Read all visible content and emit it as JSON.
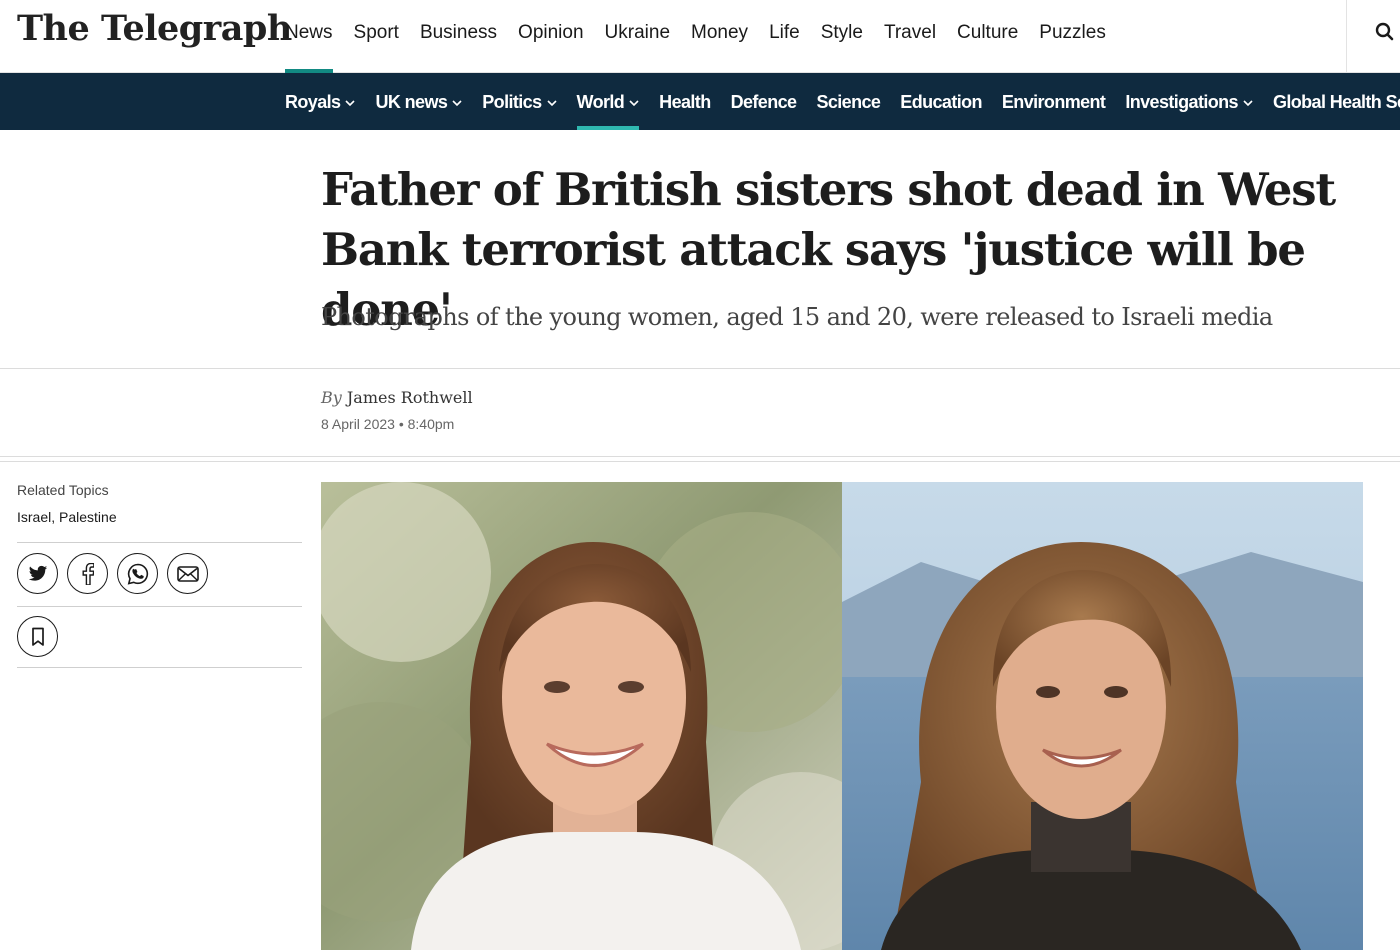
{
  "header": {
    "logo_text": "The Telegraph",
    "nav": [
      {
        "label": "News",
        "active": true
      },
      {
        "label": "Sport"
      },
      {
        "label": "Business"
      },
      {
        "label": "Opinion"
      },
      {
        "label": "Ukraine"
      },
      {
        "label": "Money"
      },
      {
        "label": "Life"
      },
      {
        "label": "Style"
      },
      {
        "label": "Travel"
      },
      {
        "label": "Culture"
      },
      {
        "label": "Puzzles"
      }
    ],
    "search_icon": "search-icon"
  },
  "section_nav": [
    {
      "label": "Royals",
      "dropdown": true
    },
    {
      "label": "UK news",
      "dropdown": true
    },
    {
      "label": "Politics",
      "dropdown": true
    },
    {
      "label": "World",
      "dropdown": true,
      "active": true
    },
    {
      "label": "Health"
    },
    {
      "label": "Defence"
    },
    {
      "label": "Science"
    },
    {
      "label": "Education"
    },
    {
      "label": "Environment"
    },
    {
      "label": "Investigations",
      "dropdown": true
    },
    {
      "label": "Global Health Security"
    }
  ],
  "article": {
    "headline": "Father of British sisters shot dead in West Bank terrorist attack says 'justice will be done'",
    "standfirst": "Photographs of the young women, aged 15 and 20, were released to Israeli media",
    "byline_prefix": "By",
    "author": "James Rothwell",
    "date": "8 April 2023 • 8:40pm"
  },
  "sidebar": {
    "related_label": "Related Topics",
    "topics": [
      "Israel",
      "Palestine"
    ],
    "share_icons": [
      "twitter-icon",
      "facebook-icon",
      "whatsapp-icon",
      "email-icon"
    ],
    "save_icon": "bookmark-icon"
  },
  "colors": {
    "brand_nav_bg": "#0f2a3f",
    "accent": "#128a83",
    "accent_light": "#2fb8b0"
  }
}
